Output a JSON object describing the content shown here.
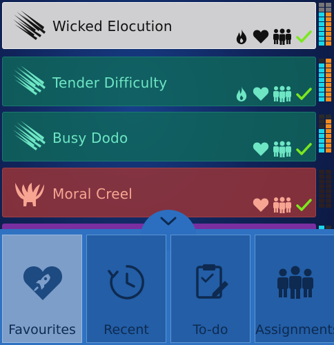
{
  "colors": {
    "teal_accent": "#6ee6c4",
    "salmon_accent": "#f7a592",
    "check_green": "#7be81e",
    "meter_cyan": "#19d7ea",
    "meter_orange": "#f28c1e",
    "panel_blue": "#2f72c2"
  },
  "items": [
    {
      "title": "Wicked Elocution",
      "emblem": "speed-lines-icon",
      "status_icons": [
        "flame-icon",
        "heart-icon",
        "people-icon",
        "check-icon"
      ],
      "meter": "cyan-orange"
    },
    {
      "title": "Tender Difficulty",
      "emblem": "speed-lines-icon",
      "status_icons": [
        "flame-icon",
        "heart-icon",
        "people-icon",
        "check-icon"
      ],
      "meter": "cyan-orange"
    },
    {
      "title": "Busy Dodo",
      "emblem": "speed-lines-icon",
      "status_icons": [
        "heart-icon",
        "people-icon",
        "check-icon"
      ],
      "meter": "cyan-orange"
    },
    {
      "title": "Moral Creel",
      "emblem": "winged-creature-icon",
      "status_icons": [
        "heart-icon",
        "people-icon",
        "check-icon"
      ],
      "meter": "dim"
    }
  ],
  "collapse_button": {
    "icon": "chevron-down-icon"
  },
  "nav": {
    "tabs": [
      {
        "label": "Favourites",
        "icon": "heart-rocket-icon",
        "active": true
      },
      {
        "label": "Recent",
        "icon": "clock-history-icon",
        "active": false
      },
      {
        "label": "To-do",
        "icon": "clipboard-pencil-icon",
        "active": false
      },
      {
        "label": "Assignments",
        "icon": "group-icon",
        "active": false
      }
    ]
  }
}
